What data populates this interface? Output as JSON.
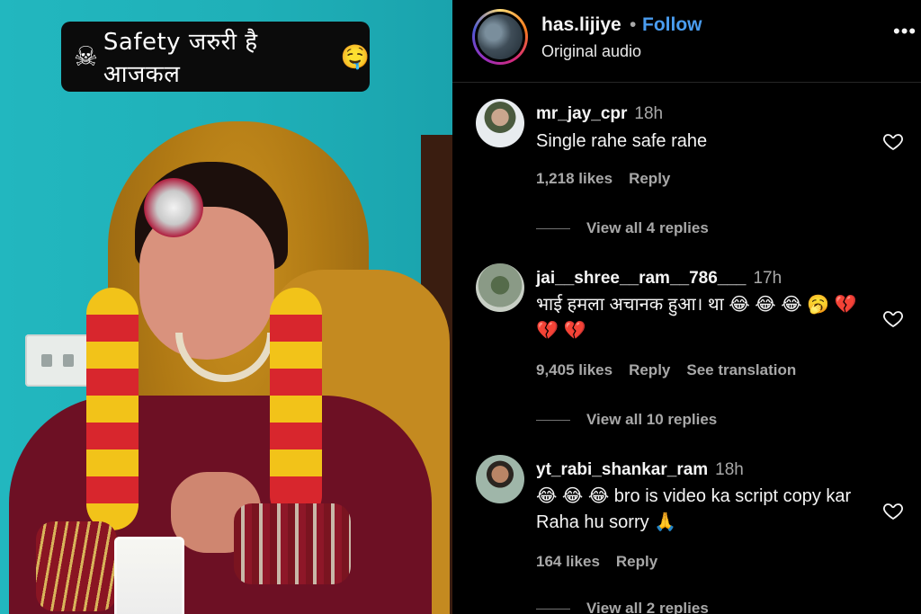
{
  "video": {
    "caption_icon": "skull-icon",
    "caption_text": "Safety जरुरी है आजकल",
    "caption_emoji": "🤤"
  },
  "header": {
    "username": "has.lijiye",
    "separator": "•",
    "follow_label": "Follow",
    "audio_label": "Original audio",
    "more_icon": "more-options-icon",
    "more_glyph": "•••"
  },
  "comments": [
    {
      "username": "mr_jay_cpr",
      "time": "18h",
      "text": "Single rahe safe rahe",
      "likes": "1,218 likes",
      "reply_label": "Reply",
      "view_replies": "View all 4 replies"
    },
    {
      "username": "jai__shree__ram__786___",
      "time": "17h",
      "text": "भाई हमला अचानक हुआ। था 😂 😂 😂 🥱 💔 💔 💔",
      "likes": "9,405 likes",
      "reply_label": "Reply",
      "translation_label": "See translation",
      "view_replies": "View all 10 replies"
    },
    {
      "username": "yt_rabi_shankar_ram",
      "time": "18h",
      "text": "😂 😂 😂 bro is video ka script copy kar Raha hu sorry 🙏",
      "likes": "164 likes",
      "reply_label": "Reply",
      "view_replies": "View all 2 replies"
    }
  ],
  "colors": {
    "background": "#000000",
    "follow": "#4a9df0",
    "muted": "#a8a8a8",
    "video_wall": "#1fb0b8"
  }
}
